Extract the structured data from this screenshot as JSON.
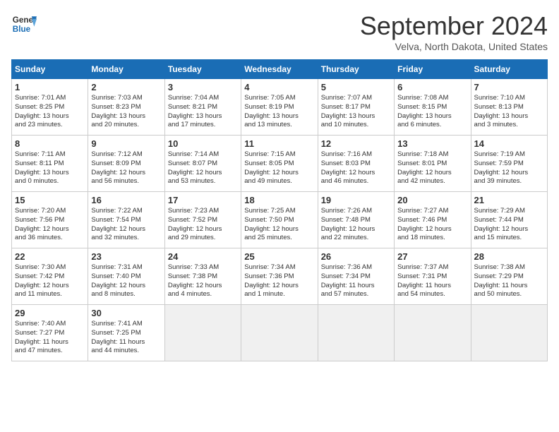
{
  "header": {
    "logo_line1": "General",
    "logo_line2": "Blue",
    "month_title": "September 2024",
    "location": "Velva, North Dakota, United States"
  },
  "days_of_week": [
    "Sunday",
    "Monday",
    "Tuesday",
    "Wednesday",
    "Thursday",
    "Friday",
    "Saturday"
  ],
  "weeks": [
    [
      {
        "day": 1,
        "lines": [
          "Sunrise: 7:01 AM",
          "Sunset: 8:25 PM",
          "Daylight: 13 hours",
          "and 23 minutes."
        ]
      },
      {
        "day": 2,
        "lines": [
          "Sunrise: 7:03 AM",
          "Sunset: 8:23 PM",
          "Daylight: 13 hours",
          "and 20 minutes."
        ]
      },
      {
        "day": 3,
        "lines": [
          "Sunrise: 7:04 AM",
          "Sunset: 8:21 PM",
          "Daylight: 13 hours",
          "and 17 minutes."
        ]
      },
      {
        "day": 4,
        "lines": [
          "Sunrise: 7:05 AM",
          "Sunset: 8:19 PM",
          "Daylight: 13 hours",
          "and 13 minutes."
        ]
      },
      {
        "day": 5,
        "lines": [
          "Sunrise: 7:07 AM",
          "Sunset: 8:17 PM",
          "Daylight: 13 hours",
          "and 10 minutes."
        ]
      },
      {
        "day": 6,
        "lines": [
          "Sunrise: 7:08 AM",
          "Sunset: 8:15 PM",
          "Daylight: 13 hours",
          "and 6 minutes."
        ]
      },
      {
        "day": 7,
        "lines": [
          "Sunrise: 7:10 AM",
          "Sunset: 8:13 PM",
          "Daylight: 13 hours",
          "and 3 minutes."
        ]
      }
    ],
    [
      {
        "day": 8,
        "lines": [
          "Sunrise: 7:11 AM",
          "Sunset: 8:11 PM",
          "Daylight: 13 hours",
          "and 0 minutes."
        ]
      },
      {
        "day": 9,
        "lines": [
          "Sunrise: 7:12 AM",
          "Sunset: 8:09 PM",
          "Daylight: 12 hours",
          "and 56 minutes."
        ]
      },
      {
        "day": 10,
        "lines": [
          "Sunrise: 7:14 AM",
          "Sunset: 8:07 PM",
          "Daylight: 12 hours",
          "and 53 minutes."
        ]
      },
      {
        "day": 11,
        "lines": [
          "Sunrise: 7:15 AM",
          "Sunset: 8:05 PM",
          "Daylight: 12 hours",
          "and 49 minutes."
        ]
      },
      {
        "day": 12,
        "lines": [
          "Sunrise: 7:16 AM",
          "Sunset: 8:03 PM",
          "Daylight: 12 hours",
          "and 46 minutes."
        ]
      },
      {
        "day": 13,
        "lines": [
          "Sunrise: 7:18 AM",
          "Sunset: 8:01 PM",
          "Daylight: 12 hours",
          "and 42 minutes."
        ]
      },
      {
        "day": 14,
        "lines": [
          "Sunrise: 7:19 AM",
          "Sunset: 7:59 PM",
          "Daylight: 12 hours",
          "and 39 minutes."
        ]
      }
    ],
    [
      {
        "day": 15,
        "lines": [
          "Sunrise: 7:20 AM",
          "Sunset: 7:56 PM",
          "Daylight: 12 hours",
          "and 36 minutes."
        ]
      },
      {
        "day": 16,
        "lines": [
          "Sunrise: 7:22 AM",
          "Sunset: 7:54 PM",
          "Daylight: 12 hours",
          "and 32 minutes."
        ]
      },
      {
        "day": 17,
        "lines": [
          "Sunrise: 7:23 AM",
          "Sunset: 7:52 PM",
          "Daylight: 12 hours",
          "and 29 minutes."
        ]
      },
      {
        "day": 18,
        "lines": [
          "Sunrise: 7:25 AM",
          "Sunset: 7:50 PM",
          "Daylight: 12 hours",
          "and 25 minutes."
        ]
      },
      {
        "day": 19,
        "lines": [
          "Sunrise: 7:26 AM",
          "Sunset: 7:48 PM",
          "Daylight: 12 hours",
          "and 22 minutes."
        ]
      },
      {
        "day": 20,
        "lines": [
          "Sunrise: 7:27 AM",
          "Sunset: 7:46 PM",
          "Daylight: 12 hours",
          "and 18 minutes."
        ]
      },
      {
        "day": 21,
        "lines": [
          "Sunrise: 7:29 AM",
          "Sunset: 7:44 PM",
          "Daylight: 12 hours",
          "and 15 minutes."
        ]
      }
    ],
    [
      {
        "day": 22,
        "lines": [
          "Sunrise: 7:30 AM",
          "Sunset: 7:42 PM",
          "Daylight: 12 hours",
          "and 11 minutes."
        ]
      },
      {
        "day": 23,
        "lines": [
          "Sunrise: 7:31 AM",
          "Sunset: 7:40 PM",
          "Daylight: 12 hours",
          "and 8 minutes."
        ]
      },
      {
        "day": 24,
        "lines": [
          "Sunrise: 7:33 AM",
          "Sunset: 7:38 PM",
          "Daylight: 12 hours",
          "and 4 minutes."
        ]
      },
      {
        "day": 25,
        "lines": [
          "Sunrise: 7:34 AM",
          "Sunset: 7:36 PM",
          "Daylight: 12 hours",
          "and 1 minute."
        ]
      },
      {
        "day": 26,
        "lines": [
          "Sunrise: 7:36 AM",
          "Sunset: 7:34 PM",
          "Daylight: 11 hours",
          "and 57 minutes."
        ]
      },
      {
        "day": 27,
        "lines": [
          "Sunrise: 7:37 AM",
          "Sunset: 7:31 PM",
          "Daylight: 11 hours",
          "and 54 minutes."
        ]
      },
      {
        "day": 28,
        "lines": [
          "Sunrise: 7:38 AM",
          "Sunset: 7:29 PM",
          "Daylight: 11 hours",
          "and 50 minutes."
        ]
      }
    ],
    [
      {
        "day": 29,
        "lines": [
          "Sunrise: 7:40 AM",
          "Sunset: 7:27 PM",
          "Daylight: 11 hours",
          "and 47 minutes."
        ]
      },
      {
        "day": 30,
        "lines": [
          "Sunrise: 7:41 AM",
          "Sunset: 7:25 PM",
          "Daylight: 11 hours",
          "and 44 minutes."
        ]
      },
      null,
      null,
      null,
      null,
      null
    ]
  ]
}
